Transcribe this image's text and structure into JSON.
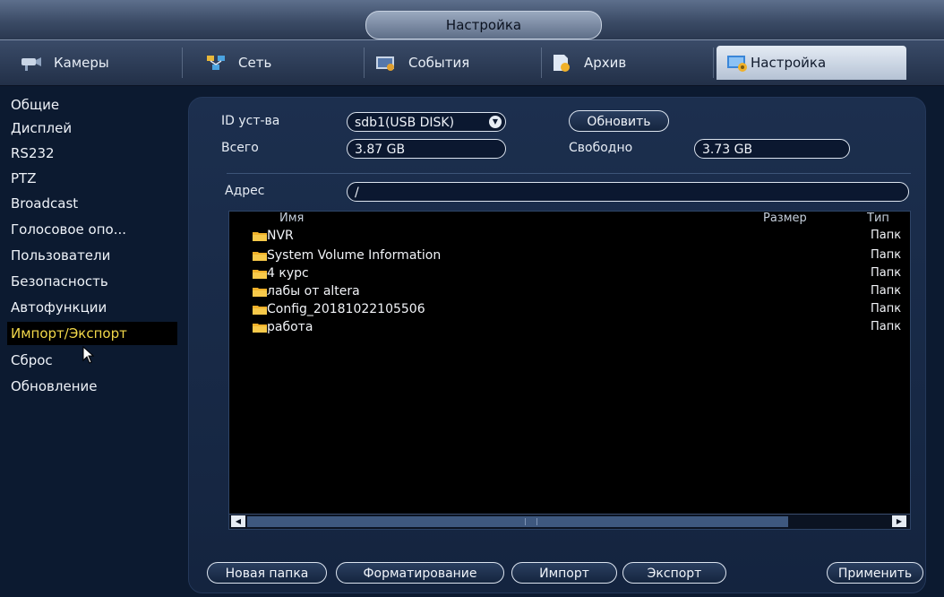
{
  "window": {
    "title": "Настройка"
  },
  "tabs": [
    {
      "label": "Камеры",
      "icon": "camera-icon"
    },
    {
      "label": "Сеть",
      "icon": "network-icon"
    },
    {
      "label": "События",
      "icon": "events-icon"
    },
    {
      "label": "Архив",
      "icon": "archive-icon"
    },
    {
      "label": "Настройка",
      "icon": "settings-icon",
      "active": true
    }
  ],
  "sidebar": {
    "items": [
      {
        "label": "Общие"
      },
      {
        "label": "Дисплей"
      },
      {
        "label": "RS232"
      },
      {
        "label": "PTZ"
      },
      {
        "label": "Broadcast"
      },
      {
        "label": "Голосовое опо..."
      },
      {
        "label": "Пользователи"
      },
      {
        "label": "Безопасность"
      },
      {
        "label": "Автофункции"
      },
      {
        "label": "Импорт/Экспорт",
        "active": true
      },
      {
        "label": "Сброс"
      },
      {
        "label": "Обновление"
      }
    ]
  },
  "device": {
    "id_label": "ID уст-ва",
    "id_value": "sdb1(USB DISK)",
    "refresh_label": "Обновить",
    "total_label": "Всего",
    "total_value": "3.87 GB",
    "free_label": "Свободно",
    "free_value": "3.73 GB"
  },
  "address": {
    "label": "Адрес",
    "value": "/"
  },
  "files": {
    "headers": {
      "name": "Имя",
      "size": "Размер",
      "type": "Тип"
    },
    "rows": [
      {
        "name": "NVR",
        "type": "Папк"
      },
      {
        "name": "System Volume Information",
        "type": "Папк"
      },
      {
        "name": "4 курс",
        "type": "Папк"
      },
      {
        "name": "лабы от altera",
        "type": "Папк"
      },
      {
        "name": "Config_20181022105506",
        "type": "Папк"
      },
      {
        "name": "работа",
        "type": "Папк"
      }
    ]
  },
  "actions": {
    "new_folder": "Новая папка",
    "format": "Форматирование",
    "import": "Импорт",
    "export": "Экспорт",
    "apply": "Применить"
  },
  "colors": {
    "accent_active_menu": "#f2d84a",
    "folder": "#f0b12a"
  }
}
